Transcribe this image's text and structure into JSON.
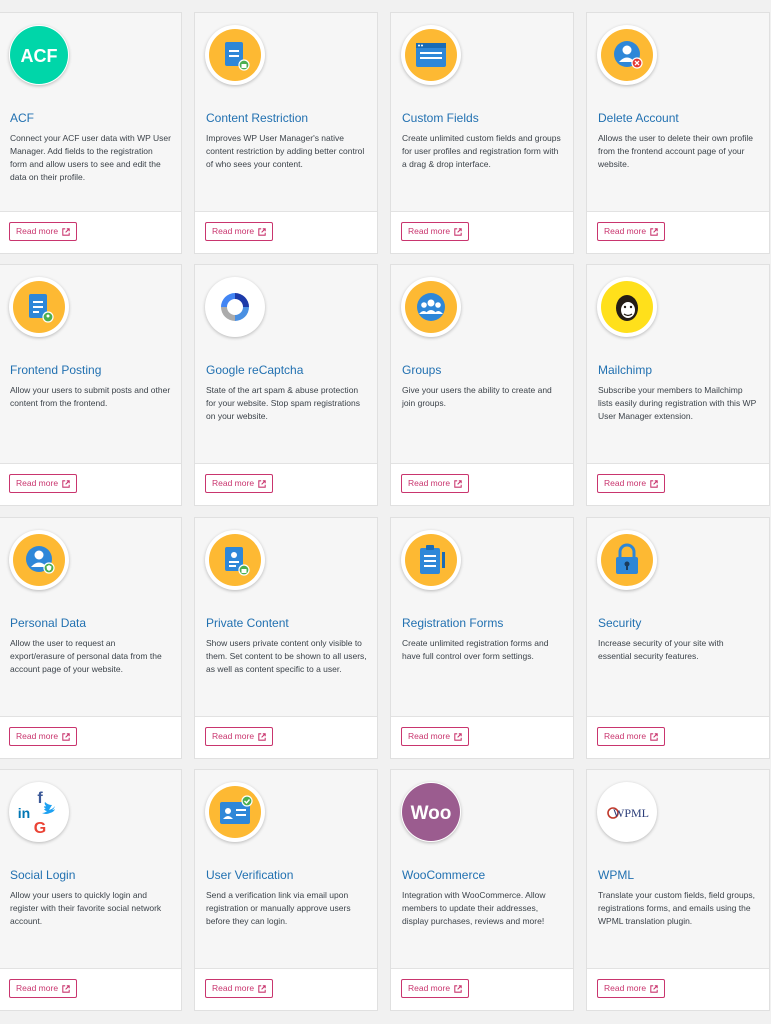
{
  "colors": {
    "accent_title": "#2271b1",
    "read_more": "#c9356e",
    "icon_yellow": "#fdb933",
    "icon_blue": "#2e87d8"
  },
  "read_more_label": "Read more",
  "read_more_icon": "external-link-icon",
  "extensions": [
    {
      "title": "ACF",
      "icon": "acf-icon",
      "description": "Connect your ACF user data with WP User Manager. Add fields to the registration form and allow users to see and edit the data on their profile."
    },
    {
      "title": "Content Restriction",
      "icon": "locked-document-icon",
      "description": "Improves WP User Manager's native content restriction by adding better control of who sees your content."
    },
    {
      "title": "Custom Fields",
      "icon": "form-window-icon",
      "description": "Create unlimited custom fields and groups for user profiles and registration form with a drag & drop interface."
    },
    {
      "title": "Delete Account",
      "icon": "user-remove-icon",
      "description": "Allows the user to delete their own profile from the frontend account page of your website."
    },
    {
      "title": "Frontend Posting",
      "icon": "user-document-icon",
      "description": "Allow your users to submit posts and other content from the frontend."
    },
    {
      "title": "Google reCaptcha",
      "icon": "recaptcha-icon",
      "description": "State of the art spam & abuse protection for your website. Stop spam registrations on your website."
    },
    {
      "title": "Groups",
      "icon": "group-users-icon",
      "description": "Give your users the ability to create and join groups."
    },
    {
      "title": "Mailchimp",
      "icon": "mailchimp-icon",
      "description": "Subscribe your members to Mailchimp lists easily during registration with this WP User Manager extension."
    },
    {
      "title": "Personal Data",
      "icon": "user-shield-icon",
      "description": "Allow the user to request an export/erasure of personal data from the account page of your website."
    },
    {
      "title": "Private Content",
      "icon": "private-document-icon",
      "description": "Show users private content only visible to them. Set content to be shown to all users, as well as content specific to a user."
    },
    {
      "title": "Registration Forms",
      "icon": "clipboard-form-icon",
      "description": "Create unlimited registration forms and have full control over form settings."
    },
    {
      "title": "Security",
      "icon": "padlock-icon",
      "description": "Increase security of your site with essential security features."
    },
    {
      "title": "Social Login",
      "icon": "social-networks-icon",
      "description": "Allow your users to quickly login and register with their favorite social network account."
    },
    {
      "title": "User Verification",
      "icon": "verified-id-card-icon",
      "description": "Send a verification link via email upon registration or manually approve users before they can login."
    },
    {
      "title": "WooCommerce",
      "icon": "woocommerce-icon",
      "description": "Integration with WooCommerce. Allow members to update their addresses, display purchases, reviews and more!"
    },
    {
      "title": "WPML",
      "icon": "wpml-icon",
      "description": "Translate your custom fields, field groups, registrations forms, and emails using the WPML translation plugin."
    }
  ],
  "logo_text": {
    "acf": "ACF",
    "woocommerce": "Woo",
    "wpml": "WPML",
    "linkedin": "in",
    "facebook": "f",
    "google": "G"
  }
}
